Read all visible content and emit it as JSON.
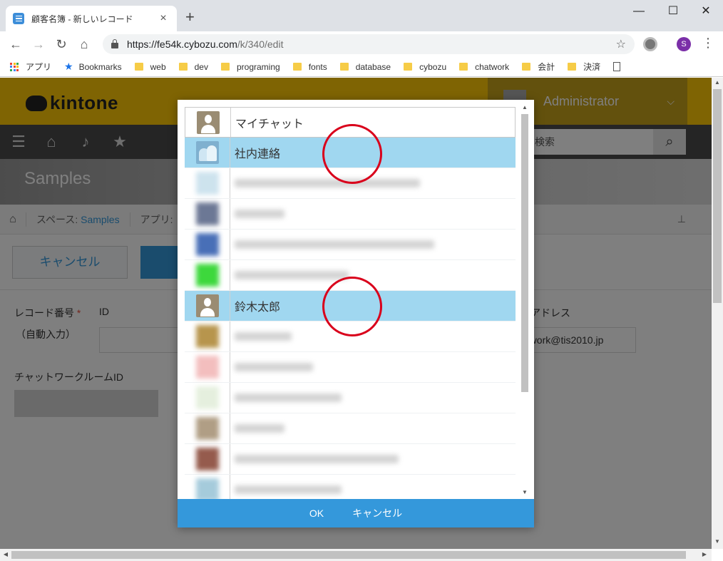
{
  "browser": {
    "tab_title": "顧客名簿 - 新しいレコード",
    "tab_close": "×",
    "new_tab": "+",
    "window_min": "—",
    "window_max": "☐",
    "window_close": "✕",
    "url_host": "https://fe54k.cybozu.com",
    "url_path": "/k/340/edit",
    "profile_initial": "S",
    "bookmarks": [
      {
        "label": "アプリ",
        "icon": "apps-grid-icon"
      },
      {
        "label": "Bookmarks",
        "icon": "star-icon"
      },
      {
        "label": "web",
        "icon": "folder-icon"
      },
      {
        "label": "dev",
        "icon": "folder-icon"
      },
      {
        "label": "programing",
        "icon": "folder-icon"
      },
      {
        "label": "fonts",
        "icon": "folder-icon"
      },
      {
        "label": "database",
        "icon": "folder-icon"
      },
      {
        "label": "cybozu",
        "icon": "folder-icon"
      },
      {
        "label": "chatwork",
        "icon": "folder-icon"
      },
      {
        "label": "会計",
        "icon": "folder-icon"
      },
      {
        "label": "決済",
        "icon": "folder-icon"
      }
    ]
  },
  "kintone": {
    "logo_text": "kintone",
    "user_name": "Administrator",
    "search_placeholder": "検索",
    "banner_title": "Samples",
    "breadcrumb": {
      "space_prefix": "スペース: ",
      "space_link": "Samples",
      "app_prefix": "アプリ:"
    },
    "cancel_label": "キャンセル",
    "form": {
      "record_number_label": "レコード番号",
      "required_mark": "*",
      "auto_input_label": "（自動入力）",
      "id_label": "ID",
      "chatwork_room_label": "チャットワークルームID",
      "email_label_partial": "ルアドレス",
      "email_value_partial": "atwork@tis2010.jp"
    }
  },
  "dialog": {
    "items": [
      {
        "name": "マイチャット",
        "avatar": "person",
        "selected": false,
        "blurred": false
      },
      {
        "name": "社内連絡",
        "avatar": "group",
        "selected": true,
        "blurred": false
      },
      {
        "name": "",
        "avatar": "blurred",
        "selected": false,
        "blurred": true
      },
      {
        "name": "",
        "avatar": "blurred",
        "selected": false,
        "blurred": true
      },
      {
        "name": "",
        "avatar": "blurred",
        "selected": false,
        "blurred": true
      },
      {
        "name": "",
        "avatar": "blurred",
        "selected": false,
        "blurred": true
      },
      {
        "name": "鈴木太郎",
        "avatar": "person",
        "selected": true,
        "blurred": false
      },
      {
        "name": "",
        "avatar": "blurred",
        "selected": false,
        "blurred": true
      },
      {
        "name": "",
        "avatar": "blurred",
        "selected": false,
        "blurred": true
      },
      {
        "name": "",
        "avatar": "blurred",
        "selected": false,
        "blurred": true
      },
      {
        "name": "",
        "avatar": "blurred",
        "selected": false,
        "blurred": true
      },
      {
        "name": "",
        "avatar": "blurred",
        "selected": false,
        "blurred": true
      },
      {
        "name": "",
        "avatar": "blurred",
        "selected": false,
        "blurred": true
      }
    ],
    "ok_label": "OK",
    "cancel_label": "キャンセル"
  },
  "colors": {
    "kintone_yellow": "#fec907",
    "selected_row": "#a0d7f0",
    "dialog_footer": "#3498db",
    "annotation_circle": "#d9001b"
  }
}
